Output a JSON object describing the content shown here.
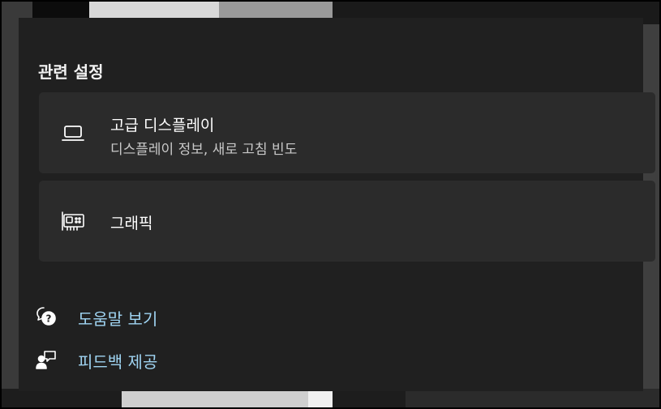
{
  "section": {
    "title": "관련 설정"
  },
  "cards": [
    {
      "title": "고급 디스플레이",
      "subtitle": "디스플레이 정보, 새로 고침 빈도",
      "icon": "laptop-icon"
    },
    {
      "title": "그래픽",
      "icon": "graphics-card-icon"
    }
  ],
  "links": [
    {
      "label": "도움말 보기",
      "icon": "help-chat-icon"
    },
    {
      "label": "피드백 제공",
      "icon": "feedback-icon"
    }
  ],
  "colors": {
    "panel": "#202020",
    "card": "#2b2b2b",
    "link": "#9fd4f2",
    "text": "#ffffff"
  }
}
